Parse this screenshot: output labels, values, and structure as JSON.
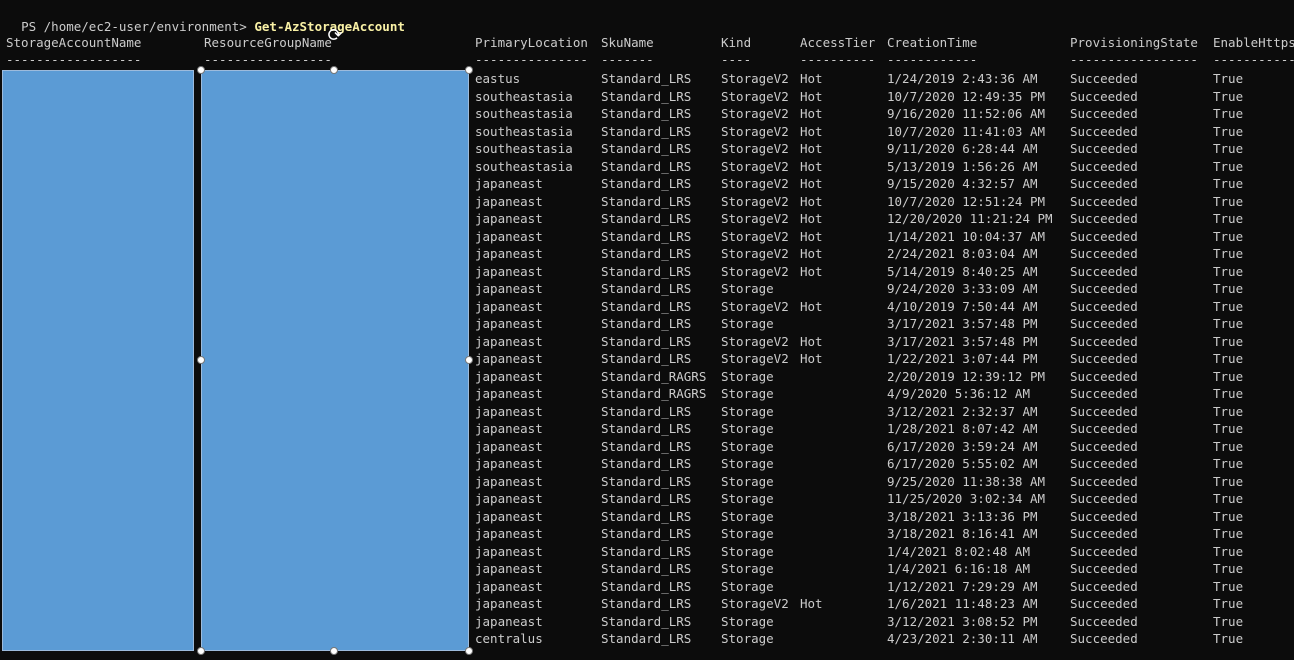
{
  "terminal": {
    "prompt": "PS /home/ec2-user/environment>",
    "command": "Get-AzStorageAccount"
  },
  "table": {
    "headers": [
      "StorageAccountName",
      "ResourceGroupName",
      "PrimaryLocation",
      "SkuName",
      "Kind",
      "AccessTier",
      "CreationTime",
      "ProvisioningState",
      "EnableHttps"
    ],
    "underlines": [
      "------------------",
      "-----------------",
      "---------------",
      "-------",
      "----",
      "----------",
      "------------",
      "-----------------",
      "-----------"
    ],
    "rows": [
      [
        "eastus",
        "Standard_LRS",
        "StorageV2",
        "Hot",
        "1/24/2019 2:43:36 AM",
        "Succeeded",
        "True"
      ],
      [
        "southeastasia",
        "Standard_LRS",
        "StorageV2",
        "Hot",
        "10/7/2020 12:49:35 PM",
        "Succeeded",
        "True"
      ],
      [
        "southeastasia",
        "Standard_LRS",
        "StorageV2",
        "Hot",
        "9/16/2020 11:52:06 AM",
        "Succeeded",
        "True"
      ],
      [
        "southeastasia",
        "Standard_LRS",
        "StorageV2",
        "Hot",
        "10/7/2020 11:41:03 AM",
        "Succeeded",
        "True"
      ],
      [
        "southeastasia",
        "Standard_LRS",
        "StorageV2",
        "Hot",
        "9/11/2020 6:28:44 AM",
        "Succeeded",
        "True"
      ],
      [
        "southeastasia",
        "Standard_LRS",
        "StorageV2",
        "Hot",
        "5/13/2019 1:56:26 AM",
        "Succeeded",
        "True"
      ],
      [
        "japaneast",
        "Standard_LRS",
        "StorageV2",
        "Hot",
        "9/15/2020 4:32:57 AM",
        "Succeeded",
        "True"
      ],
      [
        "japaneast",
        "Standard_LRS",
        "StorageV2",
        "Hot",
        "10/7/2020 12:51:24 PM",
        "Succeeded",
        "True"
      ],
      [
        "japaneast",
        "Standard_LRS",
        "StorageV2",
        "Hot",
        "12/20/2020 11:21:24 PM",
        "Succeeded",
        "True"
      ],
      [
        "japaneast",
        "Standard_LRS",
        "StorageV2",
        "Hot",
        "1/14/2021 10:04:37 AM",
        "Succeeded",
        "True"
      ],
      [
        "japaneast",
        "Standard_LRS",
        "StorageV2",
        "Hot",
        "2/24/2021 8:03:04 AM",
        "Succeeded",
        "True"
      ],
      [
        "japaneast",
        "Standard_LRS",
        "StorageV2",
        "Hot",
        "5/14/2019 8:40:25 AM",
        "Succeeded",
        "True"
      ],
      [
        "japaneast",
        "Standard_LRS",
        "Storage",
        "",
        "9/24/2020 3:33:09 AM",
        "Succeeded",
        "True"
      ],
      [
        "japaneast",
        "Standard_LRS",
        "StorageV2",
        "Hot",
        "4/10/2019 7:50:44 AM",
        "Succeeded",
        "True"
      ],
      [
        "japaneast",
        "Standard_LRS",
        "Storage",
        "",
        "3/17/2021 3:57:48 PM",
        "Succeeded",
        "True"
      ],
      [
        "japaneast",
        "Standard_LRS",
        "StorageV2",
        "Hot",
        "3/17/2021 3:57:48 PM",
        "Succeeded",
        "True"
      ],
      [
        "japaneast",
        "Standard_LRS",
        "StorageV2",
        "Hot",
        "1/22/2021 3:07:44 PM",
        "Succeeded",
        "True"
      ],
      [
        "japaneast",
        "Standard_RAGRS",
        "Storage",
        "",
        "2/20/2019 12:39:12 PM",
        "Succeeded",
        "True"
      ],
      [
        "japaneast",
        "Standard_RAGRS",
        "Storage",
        "",
        "4/9/2020 5:36:12 AM",
        "Succeeded",
        "True"
      ],
      [
        "japaneast",
        "Standard_LRS",
        "Storage",
        "",
        "3/12/2021 2:32:37 AM",
        "Succeeded",
        "True"
      ],
      [
        "japaneast",
        "Standard_LRS",
        "Storage",
        "",
        "1/28/2021 8:07:42 AM",
        "Succeeded",
        "True"
      ],
      [
        "japaneast",
        "Standard_LRS",
        "Storage",
        "",
        "6/17/2020 3:59:24 AM",
        "Succeeded",
        "True"
      ],
      [
        "japaneast",
        "Standard_LRS",
        "Storage",
        "",
        "6/17/2020 5:55:02 AM",
        "Succeeded",
        "True"
      ],
      [
        "japaneast",
        "Standard_LRS",
        "Storage",
        "",
        "9/25/2020 11:38:38 AM",
        "Succeeded",
        "True"
      ],
      [
        "japaneast",
        "Standard_LRS",
        "Storage",
        "",
        "11/25/2020 3:02:34 AM",
        "Succeeded",
        "True"
      ],
      [
        "japaneast",
        "Standard_LRS",
        "Storage",
        "",
        "3/18/2021 3:13:36 PM",
        "Succeeded",
        "True"
      ],
      [
        "japaneast",
        "Standard_LRS",
        "Storage",
        "",
        "3/18/2021 8:16:41 AM",
        "Succeeded",
        "True"
      ],
      [
        "japaneast",
        "Standard_LRS",
        "Storage",
        "",
        "1/4/2021 8:02:48 AM",
        "Succeeded",
        "True"
      ],
      [
        "japaneast",
        "Standard_LRS",
        "Storage",
        "",
        "1/4/2021 6:16:18 AM",
        "Succeeded",
        "True"
      ],
      [
        "japaneast",
        "Standard_LRS",
        "Storage",
        "",
        "1/12/2021 7:29:29 AM",
        "Succeeded",
        "True"
      ],
      [
        "japaneast",
        "Standard_LRS",
        "StorageV2",
        "Hot",
        "1/6/2021 11:48:23 AM",
        "Succeeded",
        "True"
      ],
      [
        "japaneast",
        "Standard_LRS",
        "Storage",
        "",
        "3/12/2021 3:08:52 PM",
        "Succeeded",
        "True"
      ],
      [
        "centralus",
        "Standard_LRS",
        "Storage",
        "",
        "4/23/2021 2:30:11 AM",
        "Succeeded",
        "True"
      ]
    ]
  },
  "overlay": {
    "redaction_color": "#5b9bd5",
    "rotate_icon": "rotate-icon"
  }
}
